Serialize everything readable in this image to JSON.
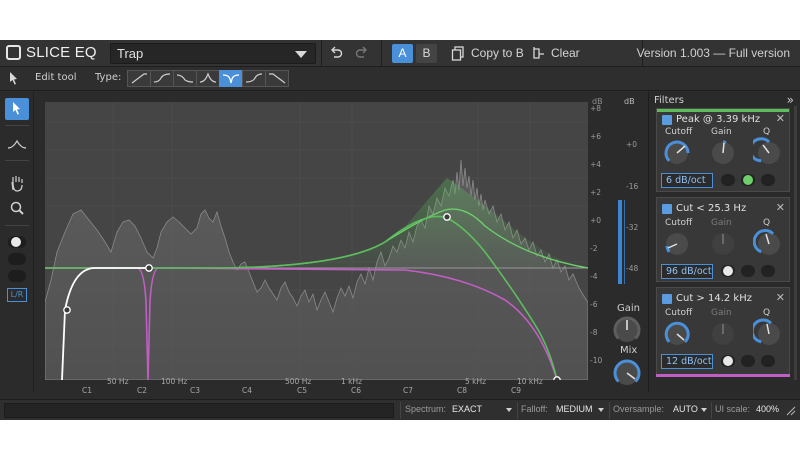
{
  "header": {
    "app_name": "SLICE EQ",
    "preset_name": "Trap",
    "ab_a": "A",
    "ab_b": "B",
    "copy_label": "Copy to B",
    "clear_label": "Clear",
    "version": "Version 1.003 — Full version"
  },
  "toolbar": {
    "edit_tool_label": "Edit tool",
    "type_label": "Type:",
    "types": [
      "low-cut",
      "low-shelf",
      "bell-dip",
      "peak",
      "notch",
      "high-shelf",
      "high-cut"
    ],
    "active_type": "notch"
  },
  "tools": {
    "items": [
      "select-tool",
      "curve-tool",
      "hand-tool",
      "zoom-tool"
    ],
    "lr_label": "L/R"
  },
  "graph": {
    "freq_top_labels": [
      "50 Hz",
      "100 Hz",
      "500 Hz",
      "1 kHz",
      "5 kHz",
      "10 kHz"
    ],
    "note_labels": [
      "C1",
      "C2",
      "C3",
      "C4",
      "C5",
      "C6",
      "C7",
      "C8",
      "C9"
    ],
    "db_scale_header": "dB",
    "db_scale": [
      "+8",
      "+6",
      "+4",
      "+2",
      "+0",
      "-2",
      "-4",
      "-6",
      "-8",
      "-10"
    ],
    "db_meter_header": "dB",
    "db_meter_scale": [
      "+0",
      "-16",
      "-32",
      "-48"
    ]
  },
  "output": {
    "gain_label": "Gain",
    "mix_label": "Mix"
  },
  "filters_panel": {
    "title": "Filters",
    "more": "»",
    "cards": [
      {
        "title": "Peak @ 3.39 kHz",
        "knob_labels": [
          "Cutoff",
          "Gain",
          "Q"
        ],
        "slope_value": "6",
        "slope_unit": "dB/oct",
        "top_color": "#5dbd5d"
      },
      {
        "title": "Cut < 25.3 Hz",
        "knob_labels": [
          "Cutoff",
          "Gain",
          "Q"
        ],
        "slope_value": "96",
        "slope_unit": "dB/oct",
        "top_color": ""
      },
      {
        "title": "Cut > 14.2 kHz",
        "knob_labels": [
          "Cutoff",
          "Gain",
          "Q"
        ],
        "slope_value": "12",
        "slope_unit": "dB/oct",
        "top_color": "#5dbd5d"
      }
    ]
  },
  "statusbar": {
    "spectrum_label": "Spectrum:",
    "spectrum_value": "EXACT",
    "falloff_label": "Falloff:",
    "falloff_value": "MEDIUM",
    "oversample_label": "Oversample:",
    "oversample_value": "AUTO",
    "ui_scale_label": "UI scale:",
    "ui_scale_value": "400%"
  },
  "colors": {
    "accent": "#4a90d9",
    "green_band": "#5dbd5d",
    "magenta_band": "#c15ec4",
    "flat_line": "#9a9a9a"
  }
}
